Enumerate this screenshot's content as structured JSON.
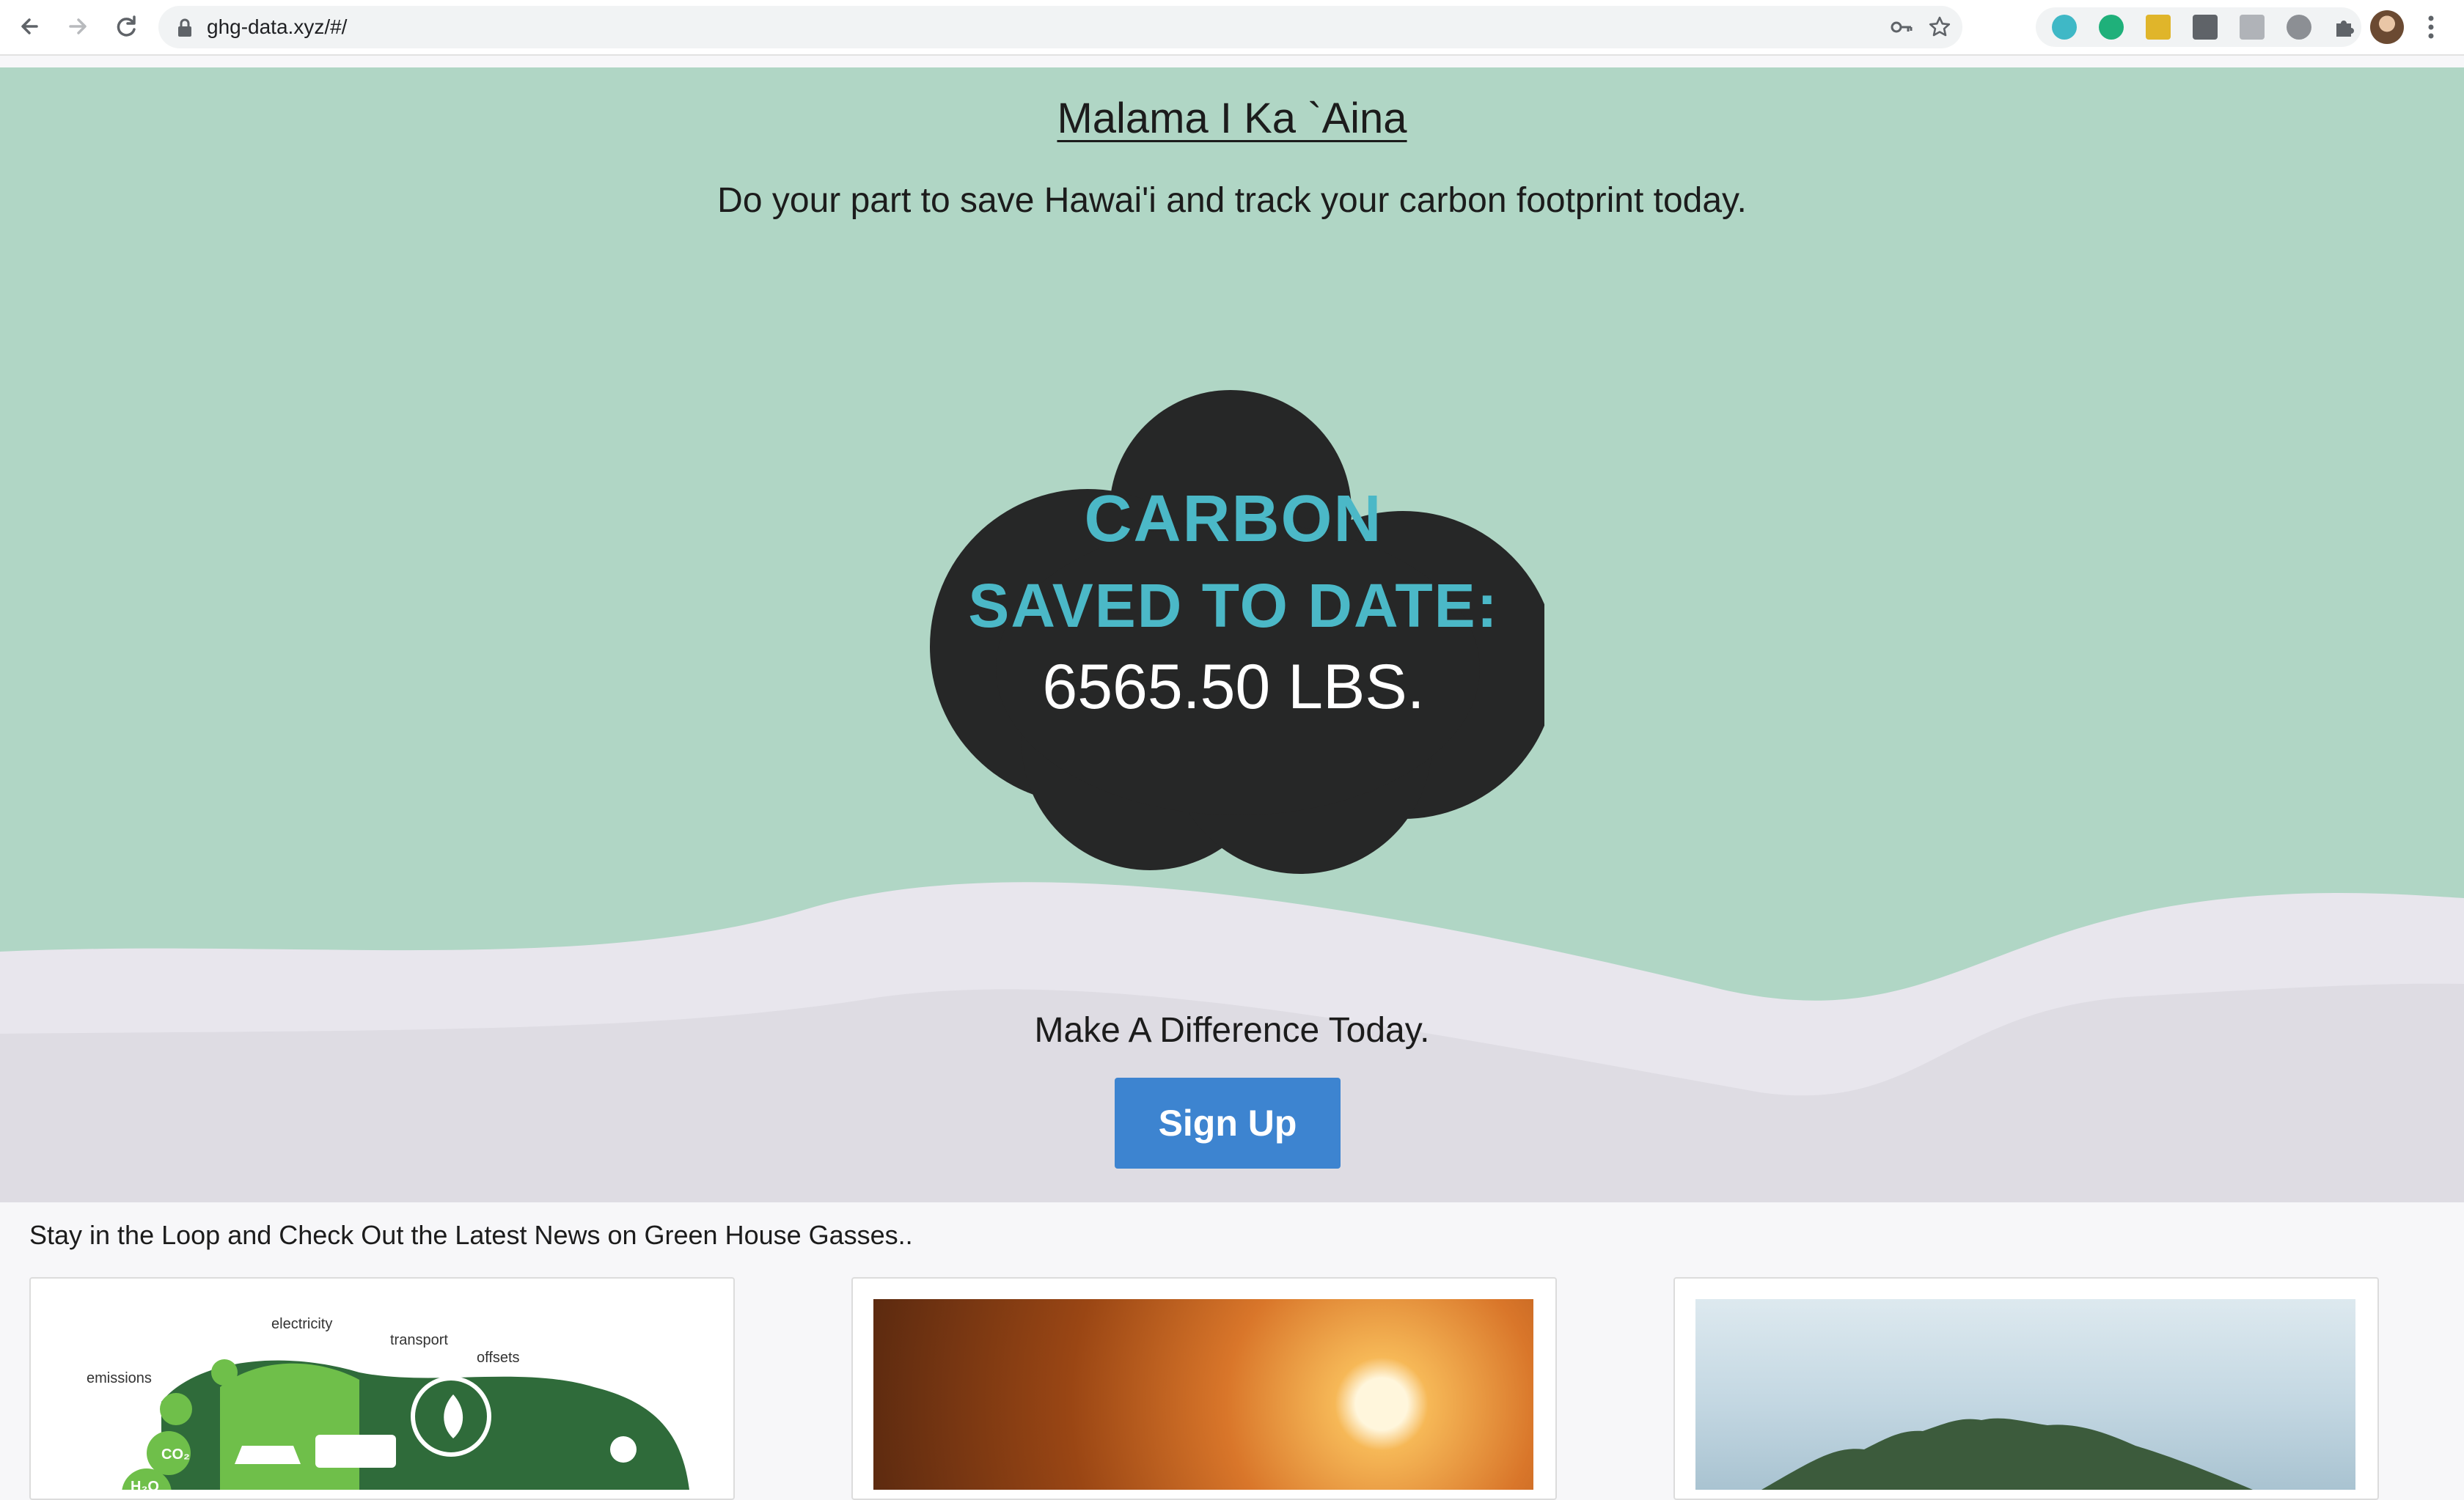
{
  "browser": {
    "url": "ghg-data.xyz/#/"
  },
  "hero": {
    "title": "Malama I Ka `Aina",
    "subtitle": "Do your part to save Hawai'i and track your carbon footprint today.",
    "cloud": {
      "line1": "CARBON",
      "line2": "SAVED TO DATE:",
      "value": "6565.50 LBS."
    }
  },
  "cta": {
    "text": "Make A Difference Today.",
    "button": "Sign Up"
  },
  "news": {
    "heading": "Stay in the Loop and Check Out the Latest News on Green House Gasses..",
    "card1_labels": {
      "electricity": "electricity",
      "transport": "transport",
      "offsets": "offsets",
      "emissions": "emissions",
      "co2": "CO₂",
      "h2o": "H₂O"
    }
  },
  "colors": {
    "hero_bg": "#b0d6c5",
    "cloud": "#262727",
    "cloud_text": "#4bb8c7",
    "button": "#3d84d0"
  }
}
